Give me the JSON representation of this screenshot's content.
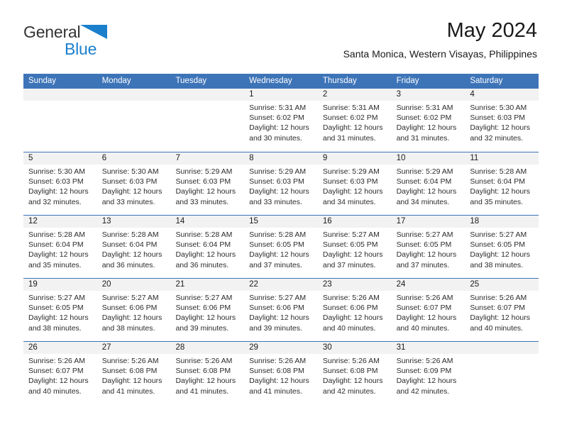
{
  "brand": {
    "name_part1": "General",
    "name_part2": "Blue",
    "triangle_color": "#1b7fcc",
    "text_color": "#333333"
  },
  "header": {
    "title": "May 2024",
    "subtitle": "Santa Monica, Western Visayas, Philippines"
  },
  "theme": {
    "header_blue": "#3d74b8",
    "daynum_band": "#f2f2f2",
    "text": "#1a1a1a"
  },
  "weekdays": [
    "Sunday",
    "Monday",
    "Tuesday",
    "Wednesday",
    "Thursday",
    "Friday",
    "Saturday"
  ],
  "weeks": [
    [
      {
        "day": "",
        "sunrise": "",
        "sunset": "",
        "daylight_line1": "",
        "daylight_line2": ""
      },
      {
        "day": "",
        "sunrise": "",
        "sunset": "",
        "daylight_line1": "",
        "daylight_line2": ""
      },
      {
        "day": "",
        "sunrise": "",
        "sunset": "",
        "daylight_line1": "",
        "daylight_line2": ""
      },
      {
        "day": "1",
        "sunrise": "Sunrise: 5:31 AM",
        "sunset": "Sunset: 6:02 PM",
        "daylight_line1": "Daylight: 12 hours",
        "daylight_line2": "and 30 minutes."
      },
      {
        "day": "2",
        "sunrise": "Sunrise: 5:31 AM",
        "sunset": "Sunset: 6:02 PM",
        "daylight_line1": "Daylight: 12 hours",
        "daylight_line2": "and 31 minutes."
      },
      {
        "day": "3",
        "sunrise": "Sunrise: 5:31 AM",
        "sunset": "Sunset: 6:02 PM",
        "daylight_line1": "Daylight: 12 hours",
        "daylight_line2": "and 31 minutes."
      },
      {
        "day": "4",
        "sunrise": "Sunrise: 5:30 AM",
        "sunset": "Sunset: 6:03 PM",
        "daylight_line1": "Daylight: 12 hours",
        "daylight_line2": "and 32 minutes."
      }
    ],
    [
      {
        "day": "5",
        "sunrise": "Sunrise: 5:30 AM",
        "sunset": "Sunset: 6:03 PM",
        "daylight_line1": "Daylight: 12 hours",
        "daylight_line2": "and 32 minutes."
      },
      {
        "day": "6",
        "sunrise": "Sunrise: 5:30 AM",
        "sunset": "Sunset: 6:03 PM",
        "daylight_line1": "Daylight: 12 hours",
        "daylight_line2": "and 33 minutes."
      },
      {
        "day": "7",
        "sunrise": "Sunrise: 5:29 AM",
        "sunset": "Sunset: 6:03 PM",
        "daylight_line1": "Daylight: 12 hours",
        "daylight_line2": "and 33 minutes."
      },
      {
        "day": "8",
        "sunrise": "Sunrise: 5:29 AM",
        "sunset": "Sunset: 6:03 PM",
        "daylight_line1": "Daylight: 12 hours",
        "daylight_line2": "and 33 minutes."
      },
      {
        "day": "9",
        "sunrise": "Sunrise: 5:29 AM",
        "sunset": "Sunset: 6:03 PM",
        "daylight_line1": "Daylight: 12 hours",
        "daylight_line2": "and 34 minutes."
      },
      {
        "day": "10",
        "sunrise": "Sunrise: 5:29 AM",
        "sunset": "Sunset: 6:04 PM",
        "daylight_line1": "Daylight: 12 hours",
        "daylight_line2": "and 34 minutes."
      },
      {
        "day": "11",
        "sunrise": "Sunrise: 5:28 AM",
        "sunset": "Sunset: 6:04 PM",
        "daylight_line1": "Daylight: 12 hours",
        "daylight_line2": "and 35 minutes."
      }
    ],
    [
      {
        "day": "12",
        "sunrise": "Sunrise: 5:28 AM",
        "sunset": "Sunset: 6:04 PM",
        "daylight_line1": "Daylight: 12 hours",
        "daylight_line2": "and 35 minutes."
      },
      {
        "day": "13",
        "sunrise": "Sunrise: 5:28 AM",
        "sunset": "Sunset: 6:04 PM",
        "daylight_line1": "Daylight: 12 hours",
        "daylight_line2": "and 36 minutes."
      },
      {
        "day": "14",
        "sunrise": "Sunrise: 5:28 AM",
        "sunset": "Sunset: 6:04 PM",
        "daylight_line1": "Daylight: 12 hours",
        "daylight_line2": "and 36 minutes."
      },
      {
        "day": "15",
        "sunrise": "Sunrise: 5:28 AM",
        "sunset": "Sunset: 6:05 PM",
        "daylight_line1": "Daylight: 12 hours",
        "daylight_line2": "and 37 minutes."
      },
      {
        "day": "16",
        "sunrise": "Sunrise: 5:27 AM",
        "sunset": "Sunset: 6:05 PM",
        "daylight_line1": "Daylight: 12 hours",
        "daylight_line2": "and 37 minutes."
      },
      {
        "day": "17",
        "sunrise": "Sunrise: 5:27 AM",
        "sunset": "Sunset: 6:05 PM",
        "daylight_line1": "Daylight: 12 hours",
        "daylight_line2": "and 37 minutes."
      },
      {
        "day": "18",
        "sunrise": "Sunrise: 5:27 AM",
        "sunset": "Sunset: 6:05 PM",
        "daylight_line1": "Daylight: 12 hours",
        "daylight_line2": "and 38 minutes."
      }
    ],
    [
      {
        "day": "19",
        "sunrise": "Sunrise: 5:27 AM",
        "sunset": "Sunset: 6:05 PM",
        "daylight_line1": "Daylight: 12 hours",
        "daylight_line2": "and 38 minutes."
      },
      {
        "day": "20",
        "sunrise": "Sunrise: 5:27 AM",
        "sunset": "Sunset: 6:06 PM",
        "daylight_line1": "Daylight: 12 hours",
        "daylight_line2": "and 38 minutes."
      },
      {
        "day": "21",
        "sunrise": "Sunrise: 5:27 AM",
        "sunset": "Sunset: 6:06 PM",
        "daylight_line1": "Daylight: 12 hours",
        "daylight_line2": "and 39 minutes."
      },
      {
        "day": "22",
        "sunrise": "Sunrise: 5:27 AM",
        "sunset": "Sunset: 6:06 PM",
        "daylight_line1": "Daylight: 12 hours",
        "daylight_line2": "and 39 minutes."
      },
      {
        "day": "23",
        "sunrise": "Sunrise: 5:26 AM",
        "sunset": "Sunset: 6:06 PM",
        "daylight_line1": "Daylight: 12 hours",
        "daylight_line2": "and 40 minutes."
      },
      {
        "day": "24",
        "sunrise": "Sunrise: 5:26 AM",
        "sunset": "Sunset: 6:07 PM",
        "daylight_line1": "Daylight: 12 hours",
        "daylight_line2": "and 40 minutes."
      },
      {
        "day": "25",
        "sunrise": "Sunrise: 5:26 AM",
        "sunset": "Sunset: 6:07 PM",
        "daylight_line1": "Daylight: 12 hours",
        "daylight_line2": "and 40 minutes."
      }
    ],
    [
      {
        "day": "26",
        "sunrise": "Sunrise: 5:26 AM",
        "sunset": "Sunset: 6:07 PM",
        "daylight_line1": "Daylight: 12 hours",
        "daylight_line2": "and 40 minutes."
      },
      {
        "day": "27",
        "sunrise": "Sunrise: 5:26 AM",
        "sunset": "Sunset: 6:08 PM",
        "daylight_line1": "Daylight: 12 hours",
        "daylight_line2": "and 41 minutes."
      },
      {
        "day": "28",
        "sunrise": "Sunrise: 5:26 AM",
        "sunset": "Sunset: 6:08 PM",
        "daylight_line1": "Daylight: 12 hours",
        "daylight_line2": "and 41 minutes."
      },
      {
        "day": "29",
        "sunrise": "Sunrise: 5:26 AM",
        "sunset": "Sunset: 6:08 PM",
        "daylight_line1": "Daylight: 12 hours",
        "daylight_line2": "and 41 minutes."
      },
      {
        "day": "30",
        "sunrise": "Sunrise: 5:26 AM",
        "sunset": "Sunset: 6:08 PM",
        "daylight_line1": "Daylight: 12 hours",
        "daylight_line2": "and 42 minutes."
      },
      {
        "day": "31",
        "sunrise": "Sunrise: 5:26 AM",
        "sunset": "Sunset: 6:09 PM",
        "daylight_line1": "Daylight: 12 hours",
        "daylight_line2": "and 42 minutes."
      },
      {
        "day": "",
        "sunrise": "",
        "sunset": "",
        "daylight_line1": "",
        "daylight_line2": ""
      }
    ]
  ]
}
